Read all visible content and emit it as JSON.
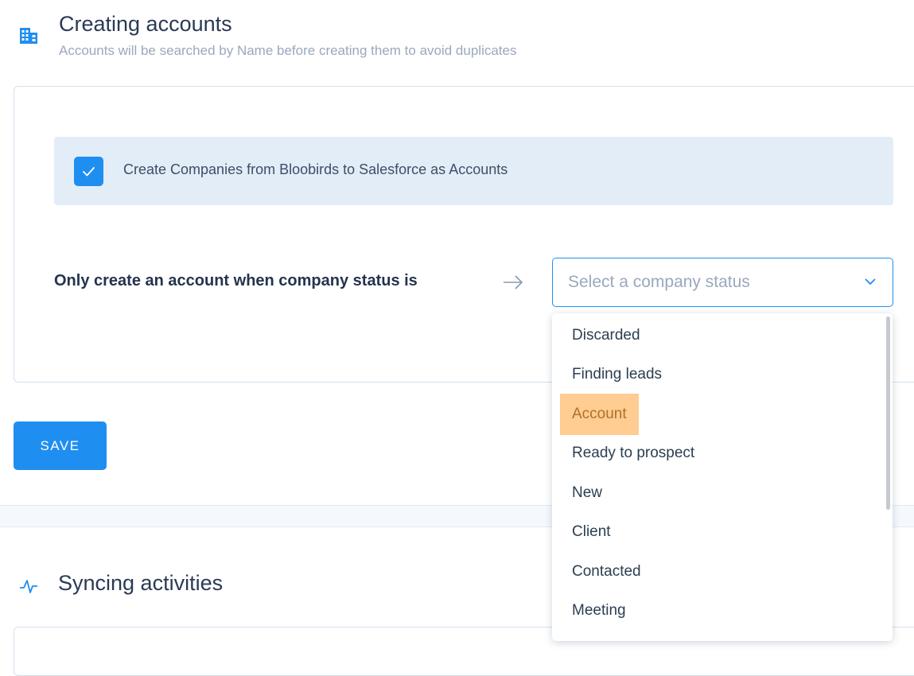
{
  "creating_accounts": {
    "icon": "building-icon",
    "title": "Creating accounts",
    "subtitle": "Accounts will be searched by Name before creating them to avoid duplicates",
    "checkbox_label": "Create Companies from Bloobirds to Salesforce as Accounts",
    "checkbox_checked": true,
    "status_label": "Only create an account when company status is",
    "select_placeholder": "Select a company status",
    "save_label": "SAVE"
  },
  "dropdown": {
    "options": [
      {
        "label": "Discarded"
      },
      {
        "label": "Finding leads"
      },
      {
        "label": "Account"
      },
      {
        "label": "Ready to prospect"
      },
      {
        "label": "New"
      },
      {
        "label": "Client"
      },
      {
        "label": "Contacted"
      },
      {
        "label": "Meeting"
      }
    ],
    "highlighted": "Account"
  },
  "syncing_activities": {
    "icon": "activity-icon",
    "title": "Syncing activities"
  },
  "colors": {
    "accent": "#1f8ef1",
    "highlight": "#ffcc91",
    "check_row_bg": "#e3edf8"
  }
}
